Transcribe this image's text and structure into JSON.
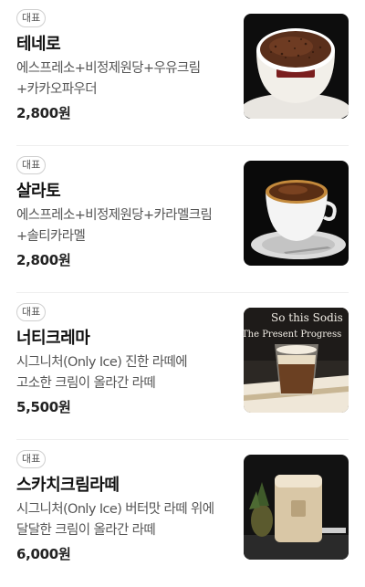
{
  "menu": {
    "items": [
      {
        "badge": "대표",
        "name": "테네로",
        "description": "에스프레소+비정제원당+우유크림+카카오파우더",
        "price": "2,800원",
        "image": "tenero-photo"
      },
      {
        "badge": "대표",
        "name": "살라토",
        "description": "에스프레소+비정제원당+카라멜크림+솔티카라멜",
        "price": "2,800원",
        "image": "salato-photo"
      },
      {
        "badge": "대표",
        "name": "너티크레마",
        "description": "시그니처(Only Ice) 진한 라떼에 고소한 크림이 올라간 라떼",
        "price": "5,500원",
        "image": "nutty-crema-photo",
        "image_text": [
          "So this Sodis",
          "The Present Progress"
        ]
      },
      {
        "badge": "대표",
        "name": "스카치크림라떼",
        "description": "시그니처(Only Ice) 버터맛 라떼 위에 달달한 크림이 올라간 라떼",
        "price": "6,000원",
        "image": "scotch-cream-latte-photo"
      }
    ]
  }
}
